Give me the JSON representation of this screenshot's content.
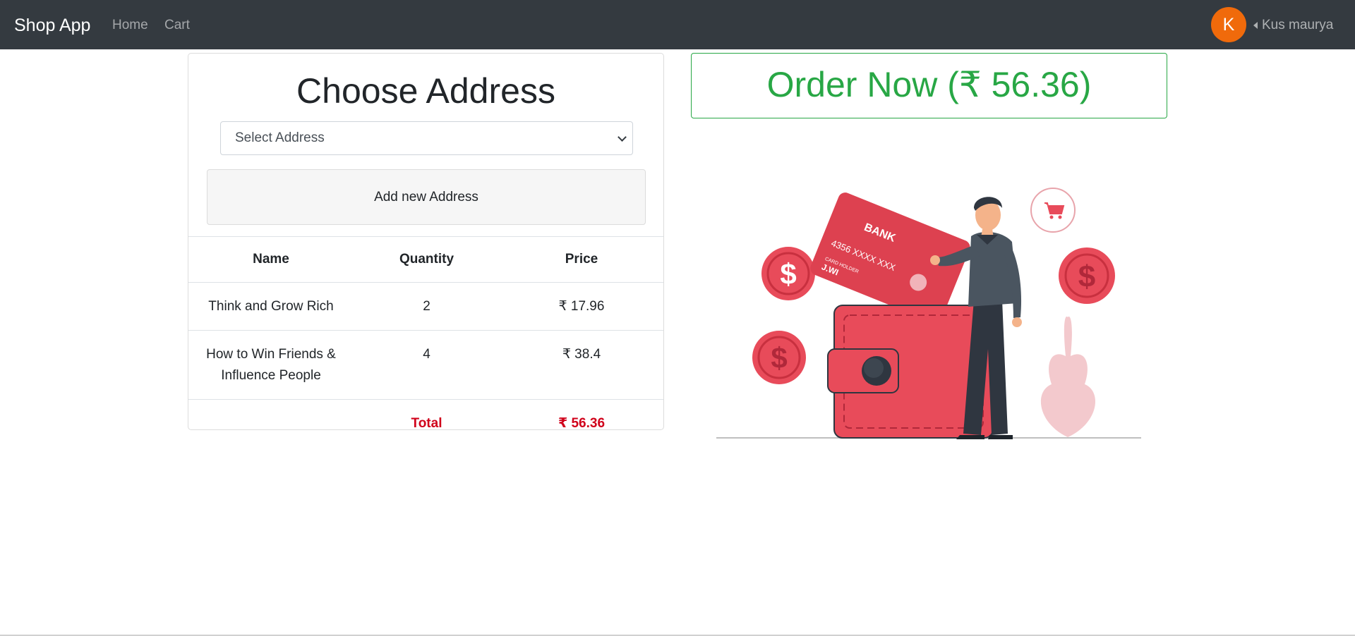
{
  "navbar": {
    "brand": "Shop App",
    "links": [
      "Home",
      "Cart"
    ],
    "avatar_initial": "K",
    "user_name": "Kus maurya"
  },
  "address": {
    "title": "Choose Address",
    "select_placeholder": "Select Address",
    "add_button": "Add new Address"
  },
  "cart": {
    "headers": [
      "Name",
      "Quantity",
      "Price"
    ],
    "items": [
      {
        "name": "Think and Grow Rich",
        "quantity": "2",
        "price": "₹ 17.96"
      },
      {
        "name": "How to Win Friends & Influence People",
        "quantity": "4",
        "price": "₹ 38.4"
      }
    ],
    "total_label": "Total",
    "total_value": "₹ 56.36"
  },
  "order": {
    "button_label": "Order Now (₹ 56.36)"
  },
  "illustration": {
    "card_text": "BANK",
    "card_number": "4356  XXXX  XXX",
    "card_holder_label": "CARD HOLDER",
    "card_holder_name": "J.WI",
    "coin_symbol": "$"
  },
  "colors": {
    "navbar_bg": "#343a40",
    "avatar_bg": "#f06a0b",
    "order_green": "#28a745",
    "total_red": "#d0021b",
    "illustration_red": "#e84b5a"
  }
}
